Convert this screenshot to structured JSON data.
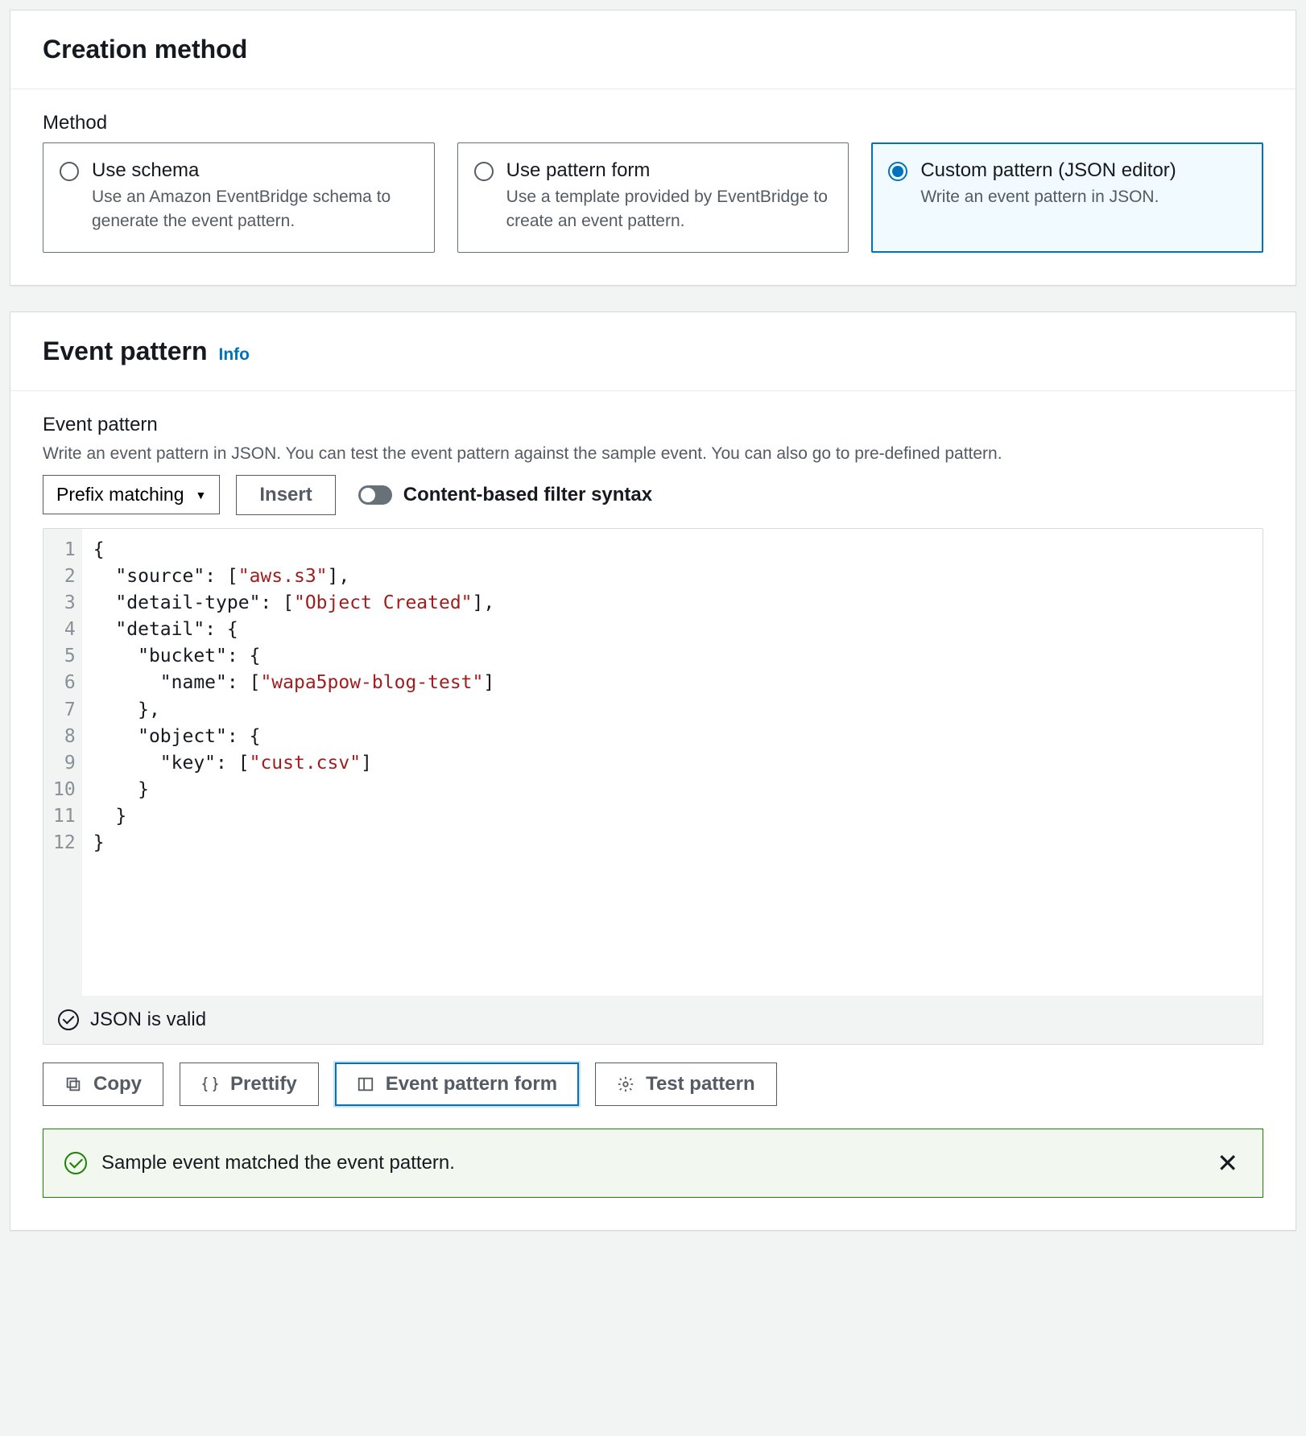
{
  "creation": {
    "title": "Creation method",
    "method_label": "Method",
    "options": [
      {
        "title": "Use schema",
        "desc": "Use an Amazon EventBridge schema to generate the event pattern."
      },
      {
        "title": "Use pattern form",
        "desc": "Use a template provided by EventBridge to create an event pattern."
      },
      {
        "title": "Custom pattern (JSON editor)",
        "desc": "Write an event pattern in JSON."
      }
    ]
  },
  "pattern": {
    "title": "Event pattern",
    "info": "Info",
    "subtitle": "Event pattern",
    "hint": "Write an event pattern in JSON. You can test the event pattern against the sample event. You can also go to pre-defined pattern.",
    "prefix_select": "Prefix matching",
    "insert_btn": "Insert",
    "toggle_label": "Content-based filter syntax",
    "code_lines": [
      {
        "n": "1",
        "tokens": [
          {
            "t": "punc",
            "v": "{"
          }
        ]
      },
      {
        "n": "2",
        "tokens": [
          {
            "t": "pad",
            "v": "  "
          },
          {
            "t": "key",
            "v": "\"source\""
          },
          {
            "t": "punc",
            "v": ": ["
          },
          {
            "t": "str",
            "v": "\"aws.s3\""
          },
          {
            "t": "punc",
            "v": "],"
          }
        ]
      },
      {
        "n": "3",
        "tokens": [
          {
            "t": "pad",
            "v": "  "
          },
          {
            "t": "key",
            "v": "\"detail-type\""
          },
          {
            "t": "punc",
            "v": ": ["
          },
          {
            "t": "str",
            "v": "\"Object Created\""
          },
          {
            "t": "punc",
            "v": "],"
          }
        ]
      },
      {
        "n": "4",
        "tokens": [
          {
            "t": "pad",
            "v": "  "
          },
          {
            "t": "key",
            "v": "\"detail\""
          },
          {
            "t": "punc",
            "v": ": {"
          }
        ]
      },
      {
        "n": "5",
        "tokens": [
          {
            "t": "pad",
            "v": "    "
          },
          {
            "t": "key",
            "v": "\"bucket\""
          },
          {
            "t": "punc",
            "v": ": {"
          }
        ]
      },
      {
        "n": "6",
        "tokens": [
          {
            "t": "pad",
            "v": "      "
          },
          {
            "t": "key",
            "v": "\"name\""
          },
          {
            "t": "punc",
            "v": ": ["
          },
          {
            "t": "str",
            "v": "\"wapa5pow-blog-test\""
          },
          {
            "t": "punc",
            "v": "]"
          }
        ]
      },
      {
        "n": "7",
        "tokens": [
          {
            "t": "pad",
            "v": "    "
          },
          {
            "t": "punc",
            "v": "},"
          }
        ]
      },
      {
        "n": "8",
        "tokens": [
          {
            "t": "pad",
            "v": "    "
          },
          {
            "t": "key",
            "v": "\"object\""
          },
          {
            "t": "punc",
            "v": ": {"
          }
        ]
      },
      {
        "n": "9",
        "tokens": [
          {
            "t": "pad",
            "v": "      "
          },
          {
            "t": "key",
            "v": "\"key\""
          },
          {
            "t": "punc",
            "v": ": ["
          },
          {
            "t": "str",
            "v": "\"cust.csv\""
          },
          {
            "t": "punc",
            "v": "]"
          }
        ]
      },
      {
        "n": "10",
        "tokens": [
          {
            "t": "pad",
            "v": "    "
          },
          {
            "t": "punc",
            "v": "}"
          }
        ]
      },
      {
        "n": "11",
        "tokens": [
          {
            "t": "pad",
            "v": "  "
          },
          {
            "t": "punc",
            "v": "}"
          }
        ]
      },
      {
        "n": "12",
        "tokens": [
          {
            "t": "punc",
            "v": "}"
          }
        ]
      }
    ],
    "validation": "JSON is valid",
    "actions": {
      "copy": "Copy",
      "prettify": "Prettify",
      "form": "Event pattern form",
      "test": "Test pattern"
    },
    "alert": "Sample event matched the event pattern."
  }
}
